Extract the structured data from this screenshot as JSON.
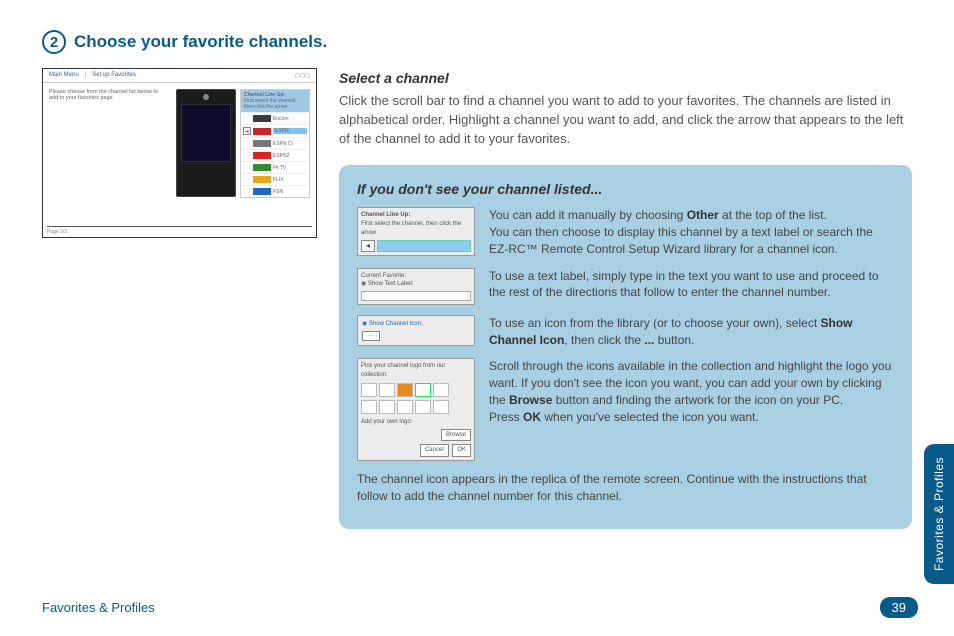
{
  "step": {
    "number": "2",
    "title": "Choose your favorite channels."
  },
  "screenshot": {
    "topbar": {
      "main": "Main Menu",
      "sub": "Set up Favorites",
      "icons": "◻◻◻"
    },
    "body_text": "Please choose from the channel list below to add to your favorites page.",
    "lineup_head": "Channel Line Up:",
    "lineup_sub": "First select the channel, then click the arrow",
    "rows": [
      {
        "logo_color": "#3b3b3b",
        "name": "Encore"
      },
      {
        "logo_color": "#c62828",
        "name": "ESPN",
        "sel": true
      },
      {
        "logo_color": "#777",
        "name": "ESPN Cl"
      },
      {
        "logo_color": "#d22",
        "name": "ESPN2"
      },
      {
        "logo_color": "#2e8b2e",
        "name": "Fit TV"
      },
      {
        "logo_color": "#e6a817",
        "name": "FLIX"
      },
      {
        "logo_color": "#1e66c9",
        "name": "FSN"
      }
    ],
    "footer": "Page 1/3"
  },
  "sub1": {
    "heading": "Select a channel",
    "text": "Click the scroll bar to find a channel you want to add to your favorites. The channels are listed in alphabetical order.  Highlight a channel you want to add, and click the arrow that appears to the left of the channel to add it to your favorites."
  },
  "callout": {
    "title": "If you don't see your channel listed...",
    "r1a": "You can add it manually by choosing ",
    "r1b": "Other",
    "r1c": " at the top of the list.",
    "r1d": "You can then choose to display this channel by a text label or search the EZ-RC™ Remote Control Setup Wizard library for a channel icon.",
    "t1_head": "Channel Line Up:",
    "t1_sub": "First select the channel, then click the arrow",
    "r2": "To use a text label, simply type in the text you want to use and proceed to the rest of the directions that follow to enter the channel number.",
    "t2_head": "Current Favorite:",
    "t2_radio": "Show Text Label:",
    "r3a": "To use an icon from the library (or to choose your own), select ",
    "r3b": "Show Channel Icon",
    "r3c": ", then click the ",
    "r3d": "...",
    "r3e": " button.",
    "t3_radio": "Show Channel Icon:",
    "r4a": "Scroll through the icons available in the collection and highlight the logo you want. If you don't see the icon you want, you can add your own by clicking the ",
    "r4b": "Browse",
    "r4c": " button and finding the artwork for the icon on your PC.",
    "r4d": "Press ",
    "r4e": "OK",
    "r4f": " when you've selected the icon you want.",
    "t4_head": "Pick your channel logo from our collection:",
    "t4_add": "Add your own logo:",
    "t4_browse": "Browse",
    "t4_cancel": "Cancel",
    "t4_ok": "OK",
    "r5": "The channel icon appears in the replica of the remote screen. Continue with the instructions that follow to add the channel number for this channel."
  },
  "footer": {
    "left": "Favorites & Profiles",
    "page": "39"
  },
  "sidetab": "Favorites & Profiles"
}
